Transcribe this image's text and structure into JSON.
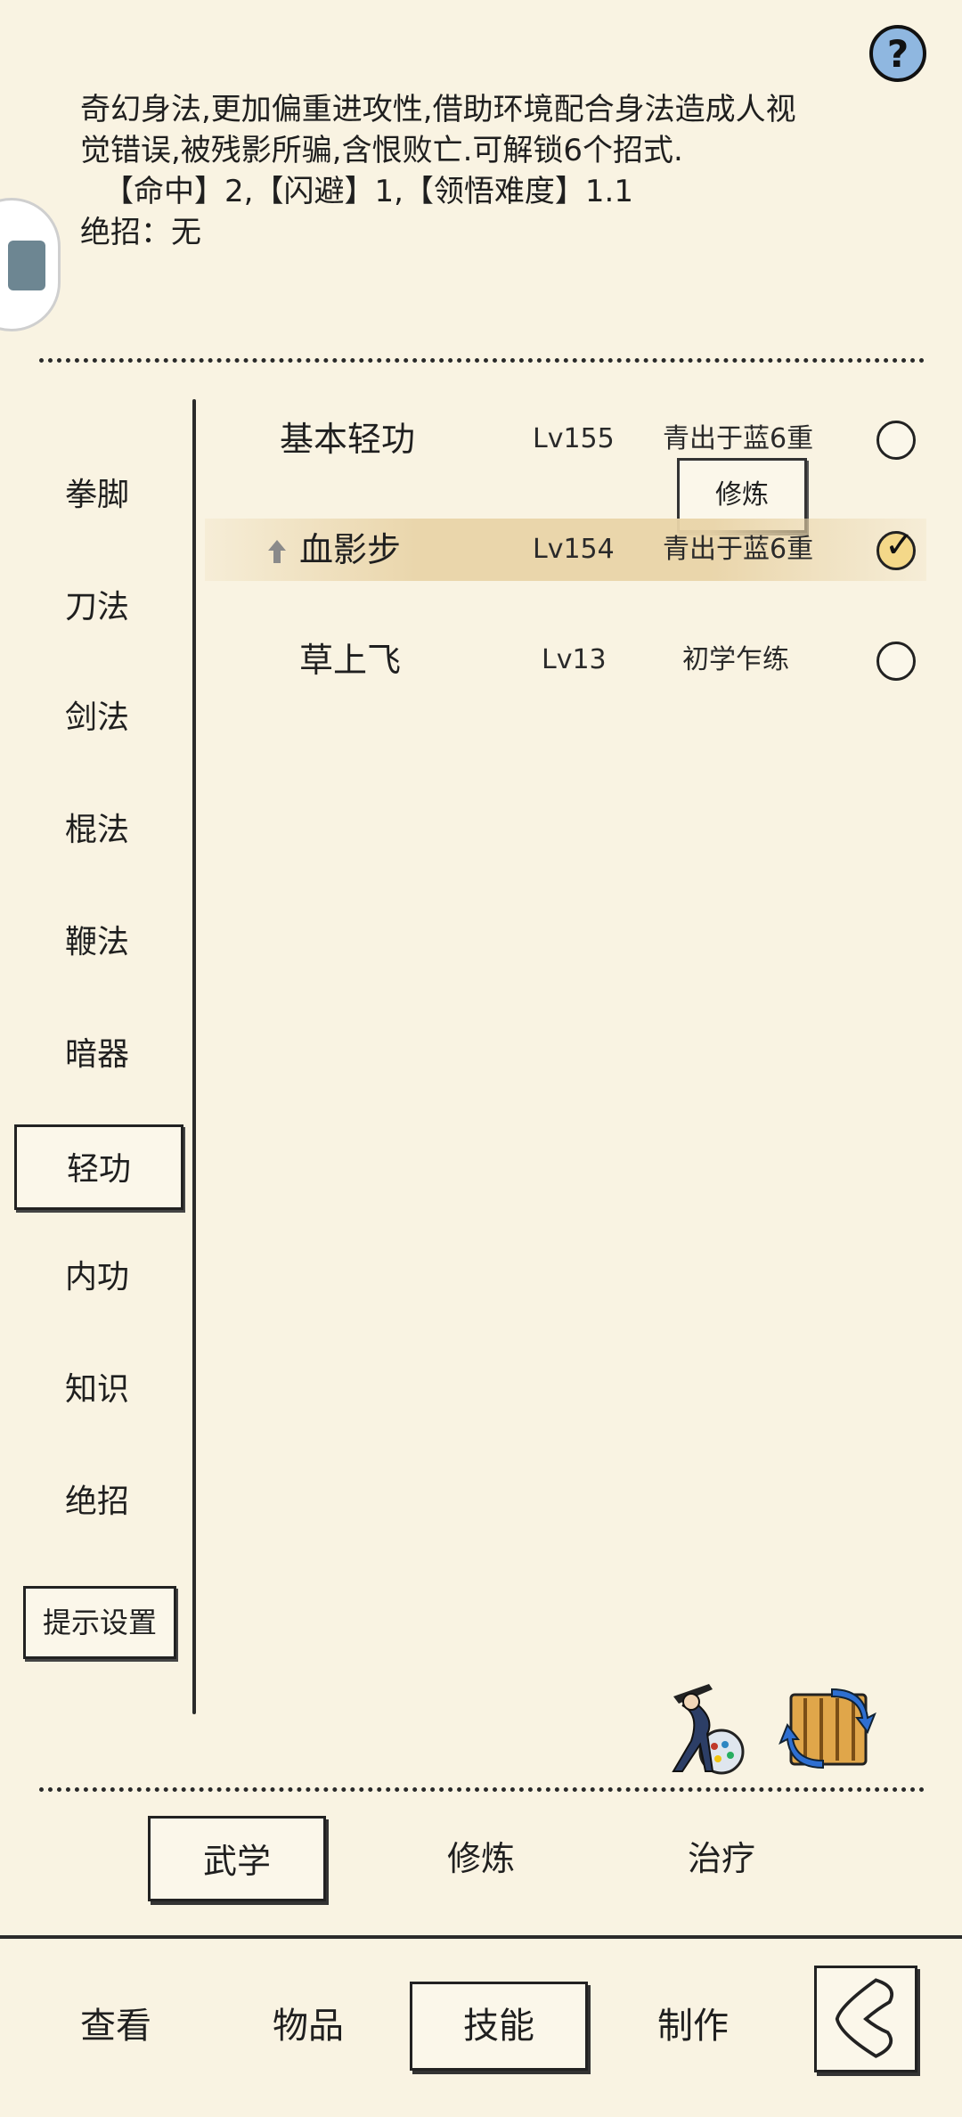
{
  "help": {
    "label": "?"
  },
  "description": {
    "line1": "奇幻身法,更加偏重进攻性,借助环境配合身法造成人视",
    "line2": "觉错误,被残影所骗,含恨败亡.可解锁6个招式.",
    "stats": "【命中】2,【闪避】1,【领悟难度】1.1",
    "ultimate": "绝招：无"
  },
  "categories": {
    "items": [
      "拳脚",
      "刀法",
      "剑法",
      "棍法",
      "鞭法",
      "暗器",
      "轻功",
      "内功",
      "知识",
      "绝招"
    ],
    "selected": "轻功",
    "hint_settings": "提示设置"
  },
  "skills": [
    {
      "name": "基本轻功",
      "level": "Lv155",
      "grade": "青出于蓝6重",
      "selected": false
    },
    {
      "name": "血影步",
      "level": "Lv154",
      "grade": "青出于蓝6重",
      "selected": true
    },
    {
      "name": "草上飞",
      "level": "Lv13",
      "grade": "初学乍练",
      "selected": false
    }
  ],
  "train_button": "修炼",
  "sub_tabs": {
    "items": [
      "武学",
      "修炼",
      "治疗"
    ],
    "selected": "武学"
  },
  "bottom_nav": {
    "items": [
      "查看",
      "物品",
      "技能",
      "制作"
    ],
    "selected": "技能"
  },
  "icons": {
    "help": "question-icon",
    "swordsman": "swordsman-icon",
    "swap": "swap-scroll-icon",
    "back": "back-arrow-icon"
  },
  "colors": {
    "background": "#f9f3e2",
    "highlight_row": "#e9d4a8",
    "help_button": "#8fb7e0"
  }
}
